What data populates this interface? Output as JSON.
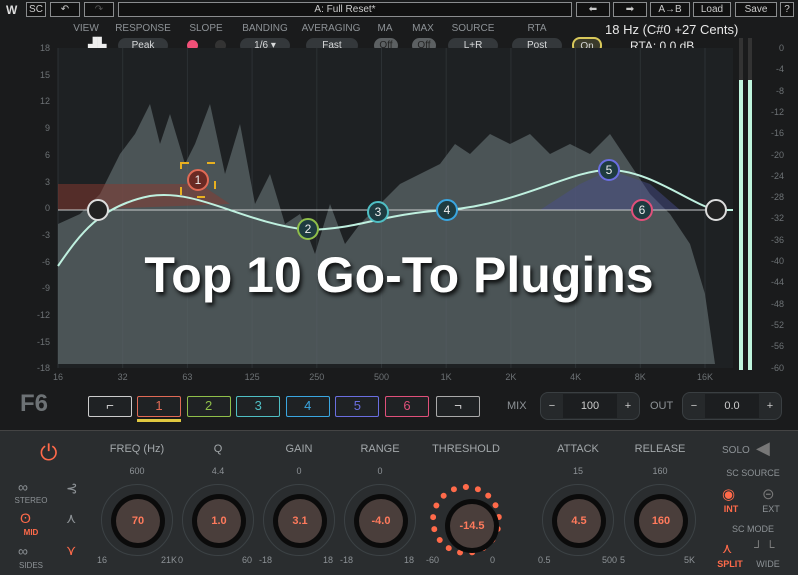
{
  "toolbar": {
    "sc": "SC",
    "undo_icon": "undo-icon",
    "redo_icon": "redo-icon",
    "preset": "A: Full Reset*",
    "prev_icon": "arrow-left-icon",
    "next_icon": "arrow-right-icon",
    "ab": "A→B",
    "load": "Load",
    "save": "Save",
    "help": "?"
  },
  "controls": {
    "view": "VIEW",
    "response": "RESPONSE",
    "response_val": "Peak",
    "slope": "SLOPE",
    "banding": "BANDING",
    "banding_val": "1/6 ▾",
    "averaging": "AVERAGING",
    "averaging_val": "Fast",
    "ma": "MA",
    "ma_val": "Off",
    "max": "MAX",
    "max_val": "Off",
    "source": "SOURCE",
    "source_val": "L+R",
    "rta": "RTA",
    "rta_val": "Post",
    "rta_on": "On",
    "hz_readout": "18 Hz (C#0 +27 Cents)",
    "rta_readout": "RTA: 0.0 dB"
  },
  "graph": {
    "left_axis": [
      "18",
      "15",
      "12",
      "9",
      "6",
      "3",
      "0",
      "-3",
      "-6",
      "-9",
      "-12",
      "-15",
      "-18"
    ],
    "right_axis": [
      "0",
      "-4",
      "-8",
      "-12",
      "-16",
      "-20",
      "-24",
      "-28",
      "-32",
      "-36",
      "-40",
      "-44",
      "-48",
      "-52",
      "-56",
      "-60"
    ],
    "freq_axis": [
      "16",
      "32",
      "63",
      "125",
      "250",
      "500",
      "1K",
      "2K",
      "4K",
      "8K",
      "16K"
    ],
    "nodes": [
      "1",
      "2",
      "3",
      "4",
      "5",
      "6"
    ],
    "meter_level_db": -8
  },
  "overlay_title": "Top 10 Go-To Plugins",
  "bands": {
    "logo": "F6",
    "buttons": [
      "1",
      "2",
      "3",
      "4",
      "5",
      "6"
    ],
    "colors": [
      "#e06a55",
      "#8fbf4a",
      "#4fbfc4",
      "#3aa6e0",
      "#6a6ee0",
      "#e0507a"
    ],
    "selected": "1",
    "mix_label": "MIX",
    "mix": "100",
    "out_label": "OUT",
    "out": "0.0",
    "minus": "−",
    "plus": "+"
  },
  "bottom": {
    "stereo": "STEREO",
    "mid": "MID",
    "sides": "SIDES",
    "knobs": [
      {
        "label": "FREQ (Hz)",
        "value": "70",
        "top": "600",
        "min": "16",
        "max": "21K"
      },
      {
        "label": "Q",
        "value": "1.0",
        "top": "4.4",
        "min": "0",
        "max": "60"
      },
      {
        "label": "GAIN",
        "value": "3.1",
        "top": "0",
        "min": "-18",
        "max": "18"
      },
      {
        "label": "RANGE",
        "value": "-4.0",
        "top": "0",
        "min": "-18",
        "max": "18"
      },
      {
        "label": "THRESHOLD",
        "value": "-14.5",
        "top": "",
        "min": "-60",
        "max": "0"
      },
      {
        "label": "ATTACK",
        "value": "4.5",
        "top": "15",
        "min": "0.5",
        "max": "500"
      },
      {
        "label": "RELEASE",
        "value": "160",
        "top": "160",
        "min": "5",
        "max": "5K"
      }
    ],
    "solo": "SOLO",
    "sc_source": "SC SOURCE",
    "int": "INT",
    "ext": "EXT",
    "sc_mode": "SC MODE",
    "split": "SPLIT",
    "wide": "WIDE"
  }
}
